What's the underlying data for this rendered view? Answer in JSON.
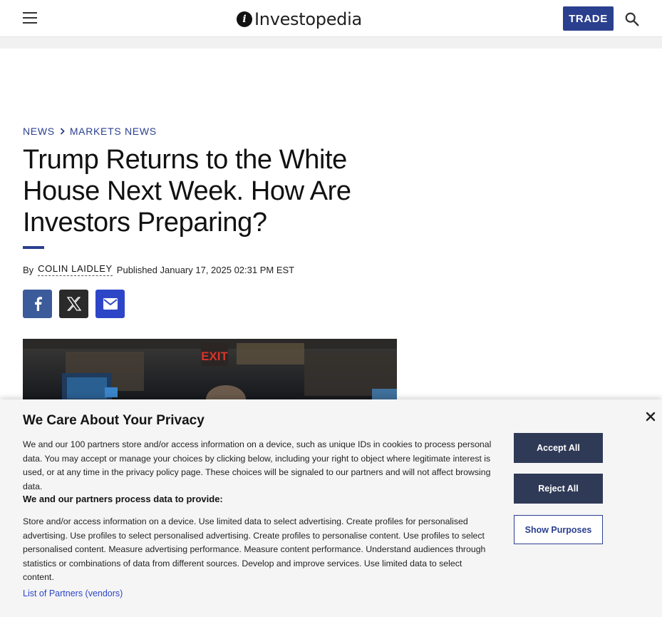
{
  "header": {
    "logo_text": "Investopedia",
    "trade_label": "TRADE"
  },
  "breadcrumb": {
    "items": [
      "NEWS",
      "MARKETS NEWS"
    ]
  },
  "article": {
    "title": "Trump Returns to the White House Next Week. How Are Investors Preparing?",
    "by": "By",
    "author": "COLIN LAIDLEY",
    "published": "Published January 17, 2025 02:31 PM EST",
    "hero_sign": "EXIT"
  },
  "privacy": {
    "title": "We Care About Your Privacy",
    "body": "We and our 100 partners store and/or access information on a device, such as unique IDs in cookies to process personal data. You may accept or manage your choices by clicking below, including your right to object where legitimate interest is used, or at any time in the privacy policy page. These choices will be signaled to our partners and will not affect browsing data.",
    "subheading": "We and our partners process data to provide:",
    "purposes": "Store and/or access information on a device. Use limited data to select advertising. Create profiles for personalised advertising. Use profiles to select personalised advertising. Create profiles to personalise content. Use profiles to select personalised content. Measure advertising performance. Measure content performance. Understand audiences through statistics or combinations of data from different sources. Develop and improve services. Use limited data to select content.",
    "partners_link": "List of Partners (vendors)",
    "accept_label": "Accept All",
    "reject_label": "Reject All",
    "show_purposes_label": "Show Purposes"
  },
  "colors": {
    "brand_blue": "#2b3f8f",
    "facebook": "#3c5b9a",
    "x": "#2a2a2a",
    "mail": "#2d46c8",
    "consent_button": "#2f3a57"
  },
  "icons": [
    "hamburger-icon",
    "search-icon",
    "chevron-right-icon",
    "facebook-icon",
    "x-icon",
    "mail-icon",
    "close-icon"
  ]
}
